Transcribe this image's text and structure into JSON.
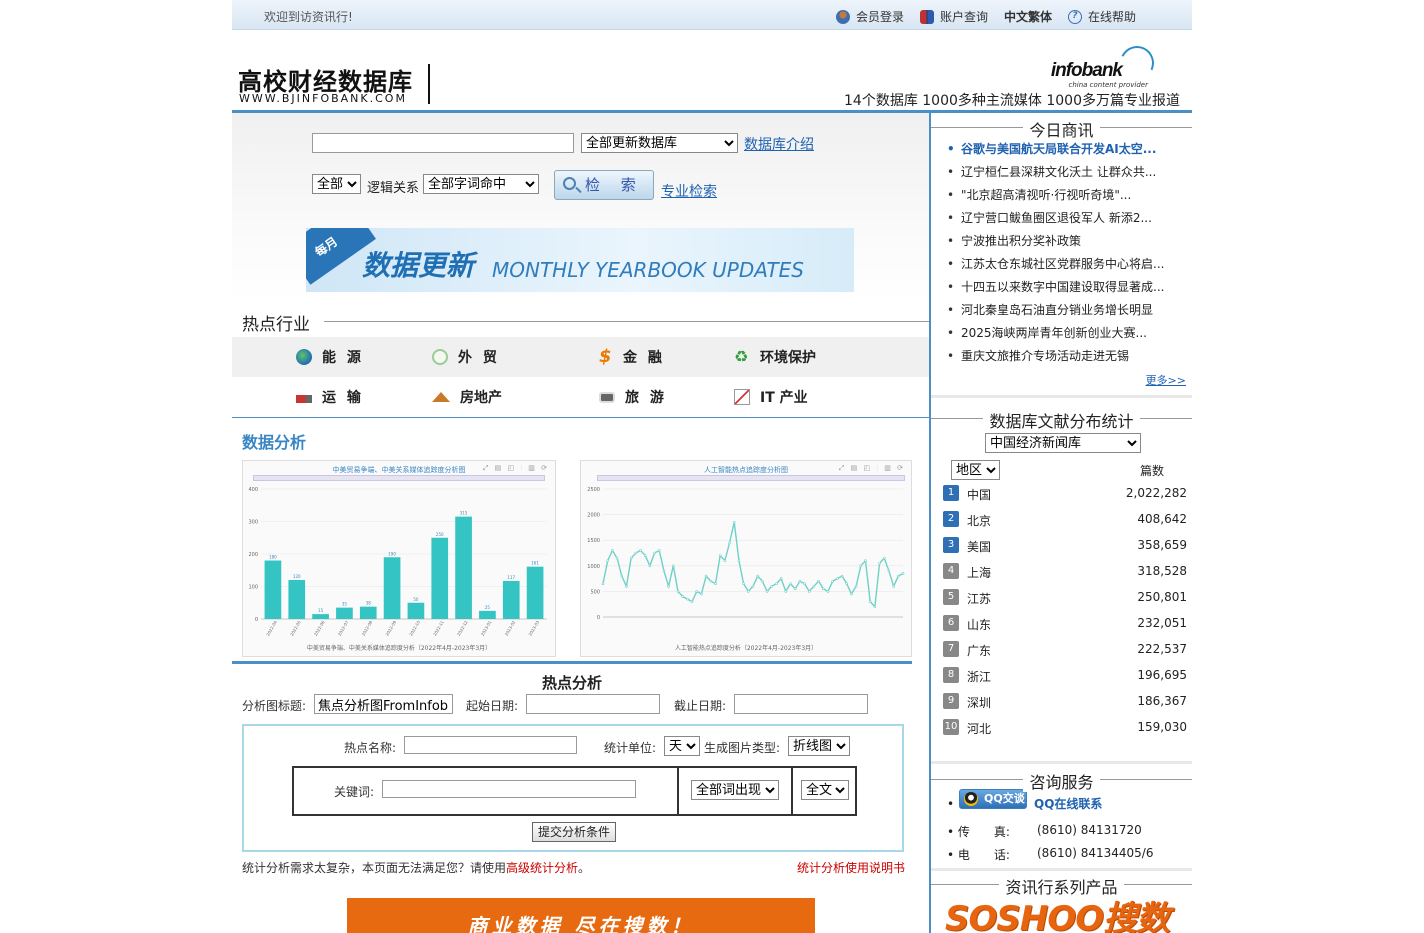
{
  "topbar": {
    "welcome": "欢迎到访资讯行!",
    "nav": [
      {
        "icon": "member-icon",
        "label": "会员登录"
      },
      {
        "icon": "account-icon",
        "label": "账户查询"
      },
      {
        "icon": "",
        "label": "中文繁体"
      },
      {
        "icon": "help-icon",
        "label": "在线帮助"
      }
    ]
  },
  "header": {
    "logo_cn": "高校财经数据库",
    "logo_url": "WWW.BJINFOBANK.COM",
    "brand": "infobank",
    "brand_sub": "china content provider",
    "slogan": "14个数据库 1000多种主流媒体 1000多万篇专业报道"
  },
  "search": {
    "query": "",
    "db_select": "全部更新数据库",
    "db_intro_link": "数据库介绍",
    "scope_select": "全部",
    "logic_label": "逻辑关系",
    "logic_select": "全部字词命中",
    "search_button": "检 索",
    "advanced_link": "专业检索"
  },
  "banner": {
    "tag": "每月",
    "cn": "数据更新",
    "en": "MONTHLY YEARBOOK UPDATES"
  },
  "industries": {
    "title": "热点行业",
    "items": [
      {
        "icon": "globe-icon",
        "label": "能 源"
      },
      {
        "icon": "trade-icon",
        "label": "外 贸"
      },
      {
        "icon": "dollar-icon",
        "label": "金 融"
      },
      {
        "icon": "recycle-icon",
        "label": "环境保护"
      },
      {
        "icon": "truck-icon",
        "label": "运 输"
      },
      {
        "icon": "house-icon",
        "label": "房地产"
      },
      {
        "icon": "camera-icon",
        "label": "旅 游"
      },
      {
        "icon": "chart-icon",
        "label": "IT 产业"
      }
    ]
  },
  "analysis": {
    "title": "数据分析"
  },
  "chart_data": [
    {
      "type": "bar",
      "title": "中美贸易争端、中美关系媒体追踪度分析图",
      "legend": "中美贸易争端、中美关系媒体追踪度分析（2022年4月-2023年3月）",
      "color": "#35c4c4",
      "categories": [
        "2022-04",
        "2022-05",
        "2022-06",
        "2022-07",
        "2022-08",
        "2022-09",
        "2022-10",
        "2022-11",
        "2022-12",
        "2023-01",
        "2023-02",
        "2023-03"
      ],
      "values": [
        180,
        120,
        15,
        35,
        38,
        190,
        50,
        250,
        315,
        25,
        117,
        161
      ],
      "ylim": [
        0,
        400
      ],
      "yticks": [
        0,
        100,
        200,
        300,
        400
      ]
    },
    {
      "type": "line",
      "title": "人工智能热点追踪度分析图",
      "legend": "人工智能热点追踪度分析（2022年4月-2023年3月）",
      "color": "#6fd0c8",
      "values": [
        650,
        1100,
        1300,
        1150,
        800,
        600,
        1150,
        1250,
        1300,
        1200,
        1000,
        1250,
        1300,
        900,
        600,
        1000,
        500,
        400,
        350,
        300,
        500,
        450,
        800,
        700,
        650,
        1200,
        1100,
        1450,
        1850,
        1100,
        650,
        500,
        600,
        800,
        700,
        500,
        600,
        650,
        750,
        500,
        650,
        550,
        700,
        650,
        500,
        600,
        700,
        550,
        500,
        700,
        750,
        800,
        650,
        450,
        600,
        1000,
        1100,
        300,
        200,
        1050,
        1150,
        900,
        600,
        800,
        850
      ],
      "ylim": [
        0,
        2500
      ],
      "yticks": [
        0,
        500,
        1000,
        1500,
        2000,
        2500
      ]
    }
  ],
  "hot_analysis": {
    "title": "热点分析",
    "chart_title_label": "分析图标题:",
    "chart_title_value": "焦点分析图FromInfobank",
    "start_label": "起始日期:",
    "end_label": "截止日期:",
    "hot_name_label": "热点名称:",
    "unit_label": "统计单位:",
    "unit_select": "天",
    "chart_type_label": "生成图片类型:",
    "chart_type_select": "折线图",
    "keyword_label": "关键词:",
    "match_select": "全部词出现",
    "range_select": "全文",
    "submit": "提交分析条件",
    "note_prefix": "统计分析需求太复杂，本页面无法满足您？请使用",
    "note_link": "高级统计分析",
    "note_suffix": "。",
    "manual_link": "统计分析使用说明书"
  },
  "bottom_banner": "商业数据 尽在搜数！",
  "news": {
    "title": "今日商讯",
    "items": [
      "谷歌与美国航天局联合开发AI太空...",
      "辽宁桓仁县深耕文化沃土 让群众共...",
      "\"北京超高清视听·行视听奇境\"...",
      "辽宁营口鲅鱼圈区退役军人 新添2...",
      "宁波推出积分奖补政策",
      "江苏太仓东城社区党群服务中心将启...",
      "十四五以来数字中国建设取得显著成...",
      "河北秦皇岛石油直分销业务增长明显",
      "2025海峡两岸青年创新创业大赛...",
      "重庆文旅推介专场活动走进无锡"
    ],
    "more": "更多>>"
  },
  "stats": {
    "title": "数据库文献分布统计",
    "db_select": "中国经济新闻库",
    "region_select": "地区",
    "count_label": "篇数",
    "rows": [
      {
        "rank": "1",
        "name": "中国",
        "value": "2,022,282"
      },
      {
        "rank": "2",
        "name": "北京",
        "value": "408,642"
      },
      {
        "rank": "3",
        "name": "美国",
        "value": "358,659"
      },
      {
        "rank": "4",
        "name": "上海",
        "value": "318,528"
      },
      {
        "rank": "5",
        "name": "江苏",
        "value": "250,801"
      },
      {
        "rank": "6",
        "name": "山东",
        "value": "232,051"
      },
      {
        "rank": "7",
        "name": "广东",
        "value": "222,537"
      },
      {
        "rank": "8",
        "name": "浙江",
        "value": "196,695"
      },
      {
        "rank": "9",
        "name": "深圳",
        "value": "186,367"
      },
      {
        "rank": "10",
        "name": "河北",
        "value": "159,030"
      }
    ]
  },
  "service": {
    "title": "咨询服务",
    "qq_badge": "QQ交谈",
    "qq_link": "QQ在线联系",
    "fax_label": "传　　真:",
    "fax": "(8610) 84131720",
    "phone_label": "电　　话:",
    "phone": "(8610) 84134405/6"
  },
  "products": {
    "title": "资讯行系列产品",
    "logo": "SOSHOO搜数"
  }
}
